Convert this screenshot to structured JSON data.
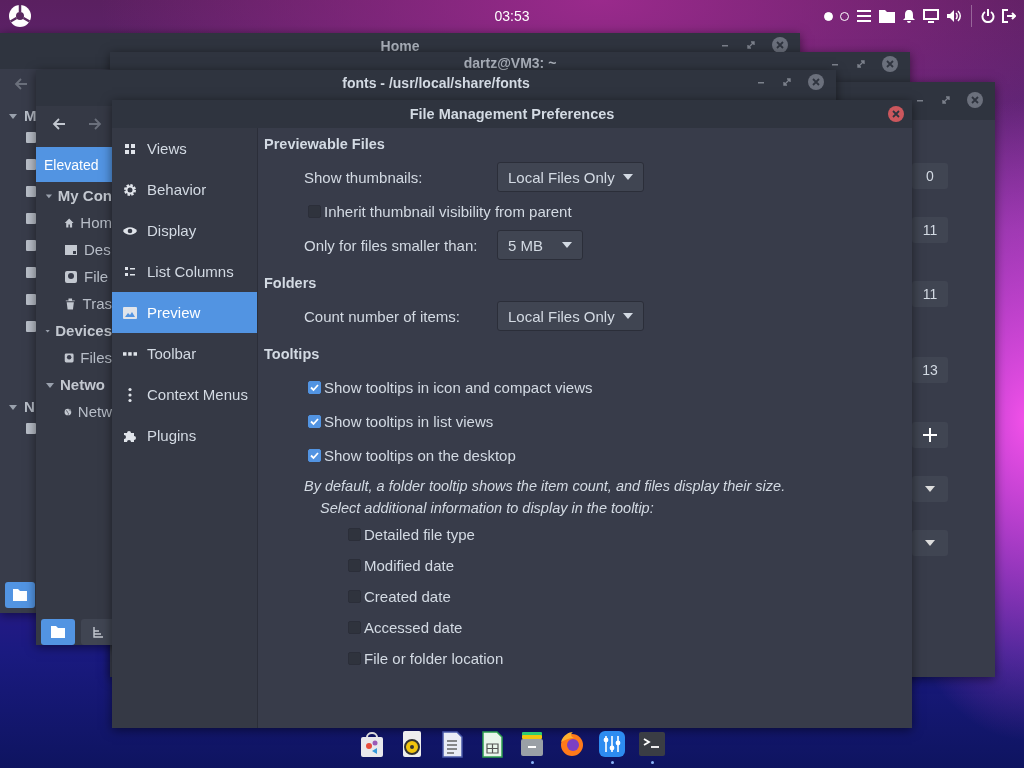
{
  "top_bar": {
    "clock": "03:53",
    "workspaces": [
      {
        "selected": true
      },
      {
        "selected": false
      }
    ]
  },
  "home_window": {
    "title": "Home",
    "tree": [
      {
        "label": "M",
        "expanded": true
      },
      {
        "label": "N",
        "expanded": true
      }
    ]
  },
  "terminal_window": {
    "title": "dartz@VM3: ~"
  },
  "settings_window": {
    "values": [
      "0",
      "11",
      "11",
      "13"
    ]
  },
  "fonts_window": {
    "title": "fonts - /usr/local/share/fonts",
    "banner": "Elevated",
    "tree": [
      {
        "label": "My Con",
        "expanded": true,
        "children": [
          {
            "label": "Hom"
          },
          {
            "label": "Des"
          },
          {
            "label": "File"
          },
          {
            "label": "Tras"
          }
        ]
      },
      {
        "label": "Devices",
        "expanded": true,
        "children": [
          {
            "label": "Files"
          }
        ]
      },
      {
        "label": "Netwo",
        "expanded": true,
        "children": [
          {
            "label": "Netw"
          }
        ]
      }
    ]
  },
  "dialog": {
    "title": "File Management Preferences",
    "nav": [
      {
        "label": "Views",
        "selected": false
      },
      {
        "label": "Behavior",
        "selected": false
      },
      {
        "label": "Display",
        "selected": false
      },
      {
        "label": "List Columns",
        "selected": false
      },
      {
        "label": "Preview",
        "selected": true
      },
      {
        "label": "Toolbar",
        "selected": false
      },
      {
        "label": "Context Menus",
        "selected": false
      },
      {
        "label": "Plugins",
        "selected": false
      }
    ],
    "sections": [
      {
        "title": "Previewable Files",
        "rows": [
          {
            "kind": "dropdown",
            "label": "Show thumbnails:",
            "value": "Local Files Only"
          },
          {
            "kind": "checkbox",
            "label": "Inherit thumbnail visibility from parent",
            "checked": false
          },
          {
            "kind": "dropdown",
            "label": "Only for files smaller than:",
            "value": "5 MB"
          }
        ]
      },
      {
        "title": "Folders",
        "rows": [
          {
            "kind": "dropdown",
            "label": "Count number of items:",
            "value": "Local Files Only"
          }
        ]
      },
      {
        "title": "Tooltips",
        "rows": [
          {
            "kind": "checkbox",
            "label": "Show tooltips in icon and compact views",
            "checked": true
          },
          {
            "kind": "checkbox",
            "label": "Show tooltips in list views",
            "checked": true
          },
          {
            "kind": "checkbox",
            "label": "Show tooltips on the desktop",
            "checked": true
          },
          {
            "kind": "note",
            "label": "By default, a folder tooltip shows the item count, and files display their size."
          },
          {
            "kind": "subnote",
            "label": "Select additional information to display in the tooltip:"
          },
          {
            "kind": "suboption",
            "label": "Detailed file type",
            "checked": false
          },
          {
            "kind": "suboption",
            "label": "Modified date",
            "checked": false
          },
          {
            "kind": "suboption",
            "label": "Created date",
            "checked": false
          },
          {
            "kind": "suboption",
            "label": "Accessed date",
            "checked": false
          },
          {
            "kind": "suboption",
            "label": "File or folder location",
            "checked": false
          }
        ]
      }
    ]
  },
  "dock": [
    {
      "running": false
    },
    {
      "running": false
    },
    {
      "running": false
    },
    {
      "running": false
    },
    {
      "running": true
    },
    {
      "running": false
    },
    {
      "running": true
    },
    {
      "running": true
    }
  ]
}
